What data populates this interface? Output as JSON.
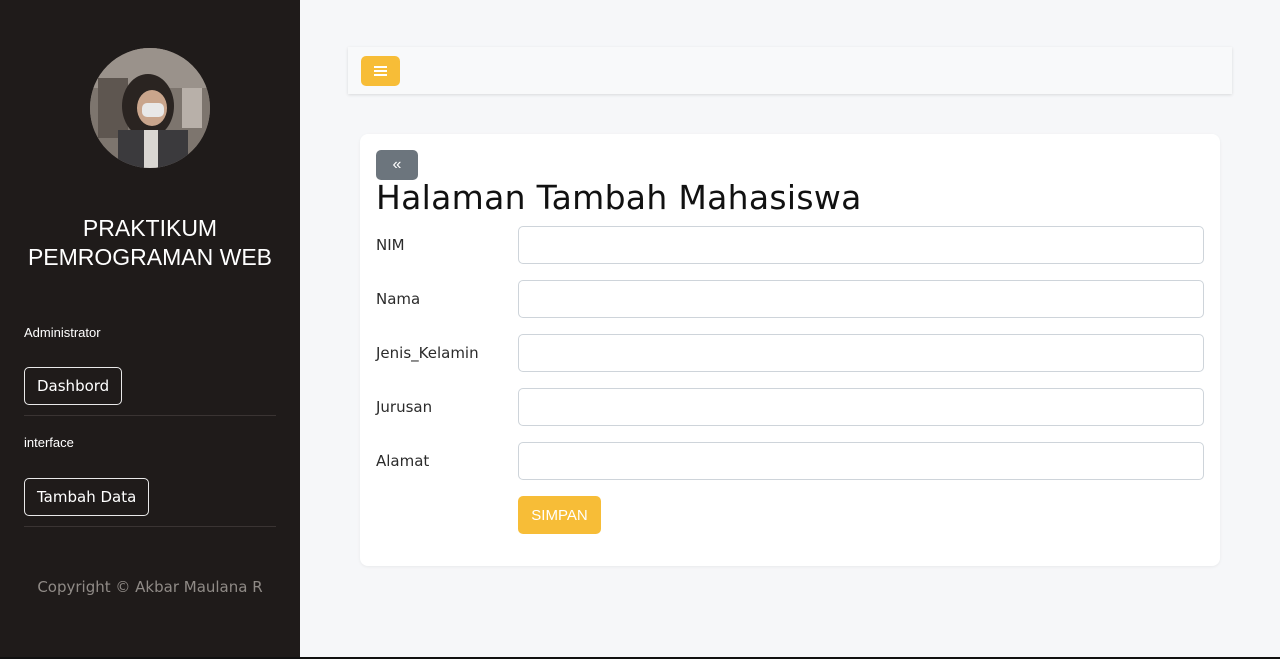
{
  "sidebar": {
    "brand_line1": "PRAKTIKUM",
    "brand_line2": "PEMROGRAMAN WEB",
    "sections": [
      {
        "label": "Administrator",
        "button": "Dashbord"
      },
      {
        "label": "interface",
        "button": "Tambah Data"
      }
    ],
    "copyright": "Copyright © Akbar Maulana R"
  },
  "topbar": {
    "toggle_icon": "menu-bars-icon"
  },
  "form": {
    "back_icon": "double-chevron-left-icon",
    "back_glyph": "«",
    "title": "Halaman Tambah Mahasiswa",
    "fields": [
      {
        "label": "NIM",
        "value": ""
      },
      {
        "label": "Nama",
        "value": ""
      },
      {
        "label": "Jenis_Kelamin",
        "value": ""
      },
      {
        "label": "Jurusan",
        "value": ""
      },
      {
        "label": "Alamat",
        "value": ""
      }
    ],
    "submit_label": "SIMPAN"
  },
  "colors": {
    "sidebar_bg": "#1f1b1a",
    "accent": "#f7bd37",
    "secondary": "#6c757d",
    "page_bg": "#f6f7f9"
  }
}
